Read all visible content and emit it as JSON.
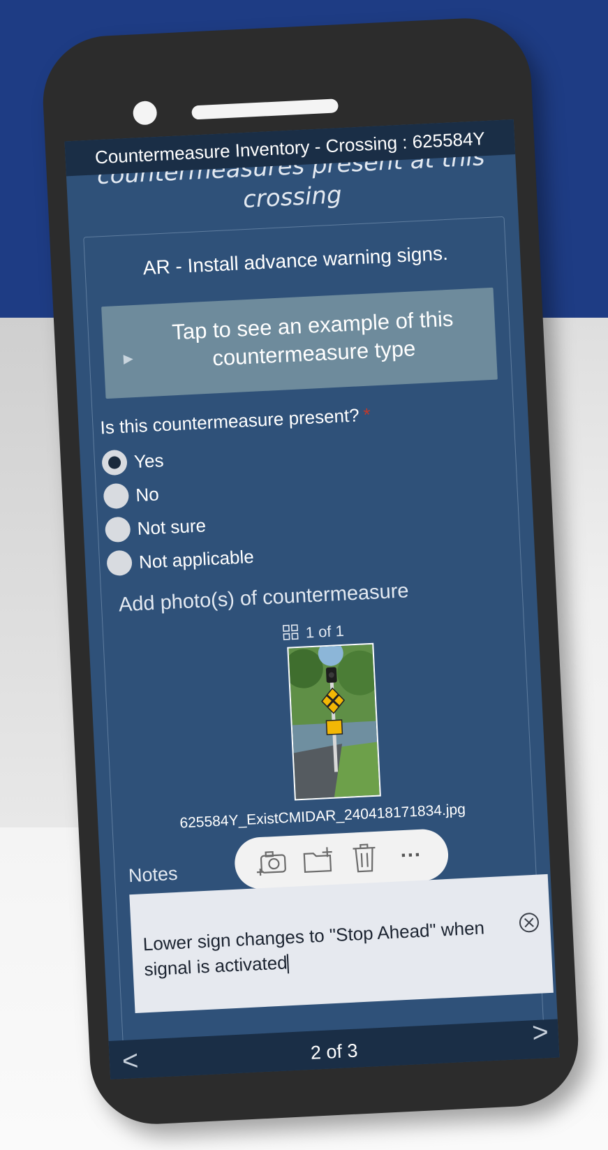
{
  "app": {
    "title": "Countermeasure Inventory - Crossing : 625584Y",
    "section_heading": "countermeasures present at this crossing"
  },
  "countermeasure": {
    "title": "AR - Install advance warning signs.",
    "example_button": "Tap to see an example of this countermeasure type"
  },
  "question": {
    "label": "Is this countermeasure present?",
    "required_mark": "*",
    "options": [
      {
        "label": "Yes",
        "selected": true
      },
      {
        "label": "No",
        "selected": false
      },
      {
        "label": "Not sure",
        "selected": false
      },
      {
        "label": "Not applicable",
        "selected": false
      }
    ]
  },
  "photos": {
    "label": "Add photo(s) of countermeasure",
    "count": "1 of 1",
    "filename": "625584Y_ExistCMIDAR_240418171834.jpg",
    "toolbar": {
      "icons": [
        "add-camera-icon",
        "add-folder-icon",
        "trash-icon",
        "more-icon"
      ],
      "more_label": "···"
    }
  },
  "notes": {
    "label": "Notes",
    "value": "Lower sign changes to \"Stop Ahead\" when signal is activated"
  },
  "navigation": {
    "page_indicator": "2 of 3",
    "prev_glyph": "<",
    "next_glyph": ">"
  },
  "colors": {
    "background_top": "#1e3c84",
    "screen": "#2f5179",
    "title_bar": "#1a2e46",
    "example_button": "#6e8b9c",
    "required": "#c0392b"
  }
}
